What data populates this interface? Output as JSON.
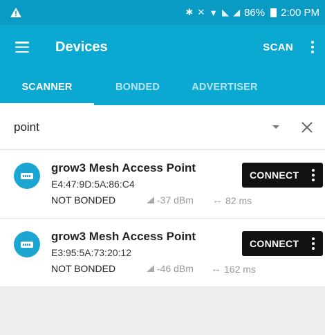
{
  "status_bar": {
    "battery": "86%",
    "time": "2:00 PM"
  },
  "app_bar": {
    "title": "Devices",
    "scan_label": "SCAN"
  },
  "tabs": [
    {
      "label": "SCANNER",
      "active": true
    },
    {
      "label": "BONDED",
      "active": false
    },
    {
      "label": "ADVERTISER",
      "active": false
    }
  ],
  "filter": {
    "value": "point"
  },
  "devices": [
    {
      "name": "grow3 Mesh Access Point",
      "mac": "E4:47:9D:5A:86:C4",
      "bond_state": "NOT BONDED",
      "rssi": "-37 dBm",
      "interval": "82 ms",
      "connect_label": "CONNECT"
    },
    {
      "name": "grow3 Mesh Access Point",
      "mac": "E3:95:5A:73:20:12",
      "bond_state": "NOT BONDED",
      "rssi": "-46 dBm",
      "interval": "162 ms",
      "connect_label": "CONNECT"
    }
  ],
  "colors": {
    "status_bar": "#0a9bc5",
    "app_bar": "#0ba9d2",
    "connect_button": "#111111",
    "device_icon": "#1aa6d0"
  },
  "icons": [
    "warning-icon",
    "bluetooth-icon",
    "mute-icon",
    "wifi-icon",
    "signal-icon",
    "battery-icon",
    "menu-icon",
    "overflow-icon",
    "dropdown-icon",
    "clear-icon",
    "device-icon",
    "rssi-icon",
    "interval-icon"
  ]
}
